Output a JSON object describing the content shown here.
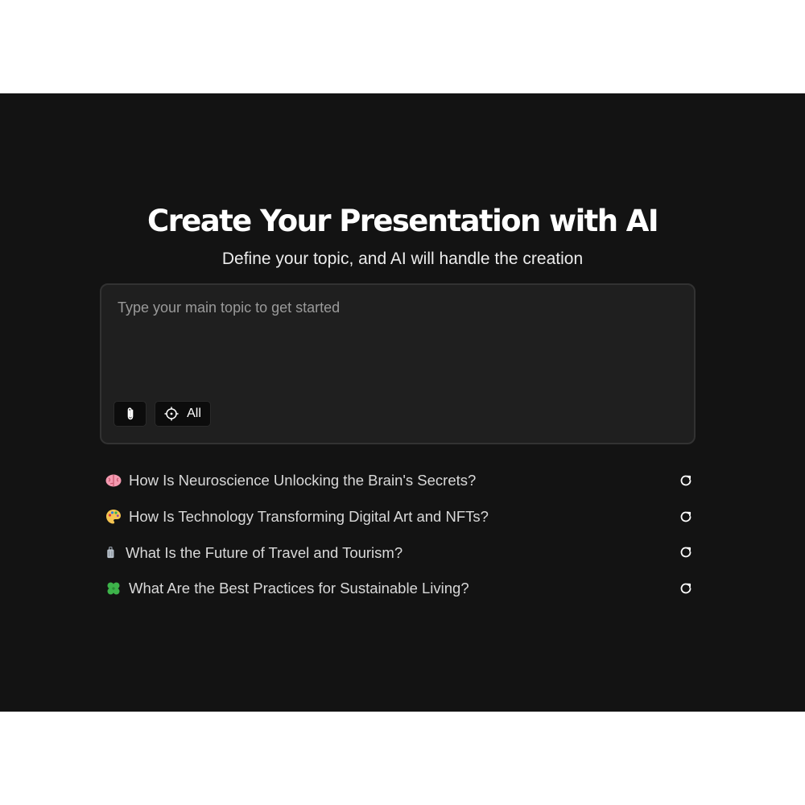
{
  "page": {
    "title": "Create Your Presentation with AI",
    "subtitle": "Define your topic, and AI will handle the creation"
  },
  "prompt": {
    "placeholder": "Type your main topic to get started",
    "value": "",
    "attach_icon": "paperclip-icon",
    "scope_icon": "crosshair-icon",
    "scope_label": "All"
  },
  "suggestions": [
    {
      "icon": "brain-emoji",
      "text": "How Is Neuroscience Unlocking the Brain's Secrets?"
    },
    {
      "icon": "artist-palette-emoji",
      "text": "How Is Technology Transforming Digital Art and NFTs?"
    },
    {
      "icon": "luggage-emoji",
      "text": "What Is the Future of Travel and Tourism?"
    },
    {
      "icon": "four-leaf-clover-emoji",
      "text": "What Are the Best Practices for Sustainable Living?"
    }
  ],
  "refresh_icon": "refresh-icon",
  "colors": {
    "background": "#131313",
    "panel": "#1f1f1f",
    "panel_border": "#323232",
    "button": "#0c0c0c",
    "text": "#ffffff",
    "muted_text": "#9a9a9a"
  }
}
